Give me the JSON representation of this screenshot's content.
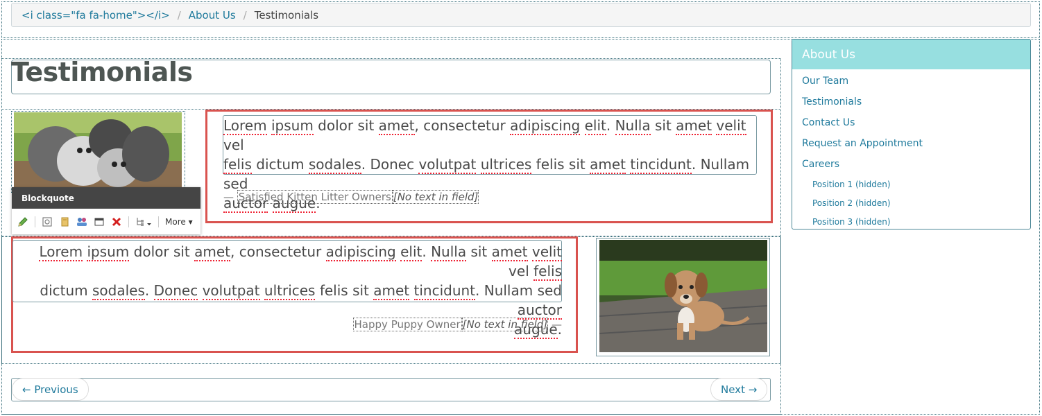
{
  "breadcrumb": {
    "home": "<i class=\"fa fa-home\"></i>",
    "sep": "/",
    "about": "About Us",
    "current": "Testimonials"
  },
  "page": {
    "title": "Testimonials"
  },
  "testimonials": [
    {
      "words": [
        "Lorem",
        "ipsum",
        "dolor sit",
        "amet",
        ", consectetur",
        "adipiscing",
        "elit",
        ".",
        "Nulla",
        "sit",
        "amet",
        "velit",
        "vel",
        "felis",
        "dictum",
        "sodales",
        ". Donec",
        "volutpat",
        "ultrices",
        "felis sit",
        "amet",
        "tincidunt",
        ". Nullam sed",
        "auctor",
        "augue",
        "."
      ],
      "cite_dash": "—",
      "author": "Satisfied Kitten Litter Owners",
      "empty_field": "[No text in field]"
    },
    {
      "author": "Happy Puppy Owner",
      "empty_field": "[No text in field]",
      "cite_dash": "—"
    }
  ],
  "quote_text": {
    "l1_a": "Lorem",
    "l1_b": "ipsum",
    "l1_c": " dolor sit ",
    "l1_d": "amet",
    "l1_e": ", consectetur ",
    "l1_f": "adipiscing",
    "l1_g": " ",
    "l1_h": "elit",
    "l1_i": ". ",
    "l1_j": "Nulla",
    "l1_k": " sit ",
    "l1_l": "amet",
    "l1_m": " ",
    "l1_n": "velit",
    "l1_o": " vel",
    "l2_a": "felis",
    "l2_b": " dictum ",
    "l2_c": "sodales",
    "l2_d": ". Donec ",
    "l2_e": "volutpat",
    "l2_f": " ",
    "l2_g": "ultrices",
    "l2_h": " felis sit ",
    "l2_i": "amet",
    "l2_j": " ",
    "l2_k": "tincidunt",
    "l2_l": ". Nullam sed",
    "l3_a": "auctor",
    "l3_b": " ",
    "l3_c": "augue",
    "l3_d": "."
  },
  "quote_text2": {
    "l1_a": "Lorem",
    "l1_b": " ",
    "l1_c": "ipsum",
    "l1_d": " dolor sit ",
    "l1_e": "amet",
    "l1_f": ", consectetur ",
    "l1_g": "adipiscing",
    "l1_h": " ",
    "l1_i": "elit",
    "l1_j": ". ",
    "l1_k": "Nulla",
    "l1_l": " sit ",
    "l1_m": "amet",
    "l1_n": " ",
    "l1_o": "velit",
    "l1_p": " vel ",
    "l1_q": "felis",
    "l2_a": "dictum ",
    "l2_b": "sodales",
    "l2_c": ". ",
    "l2_d": "Donec",
    "l2_e": " ",
    "l2_f": "volutpat",
    "l2_g": " ",
    "l2_h": "ultrices",
    "l2_i": " felis sit ",
    "l2_j": "amet",
    "l2_k": " ",
    "l2_l": "tincidunt",
    "l2_m": ". Nullam sed ",
    "l2_n": "auctor",
    "l3_a": "augue",
    "l3_b": "."
  },
  "toolbar": {
    "title": "Blockquote",
    "more_label": "More"
  },
  "pager": {
    "prev_label": "← Previous",
    "next_label": "Next →"
  },
  "sidebar": {
    "title": "About Us",
    "items": [
      "Our Team",
      "Testimonials",
      "Contact Us",
      "Request an Appointment",
      "Careers"
    ],
    "sub_items": [
      "Position 1 (hidden)",
      "Position 2 (hidden)",
      "Position 3 (hidden)"
    ]
  },
  "colors": {
    "link": "#1f7a9c",
    "sidebar_header": "#97dfe0",
    "selection_red": "#d9534f",
    "toolbar_header": "#454545"
  }
}
